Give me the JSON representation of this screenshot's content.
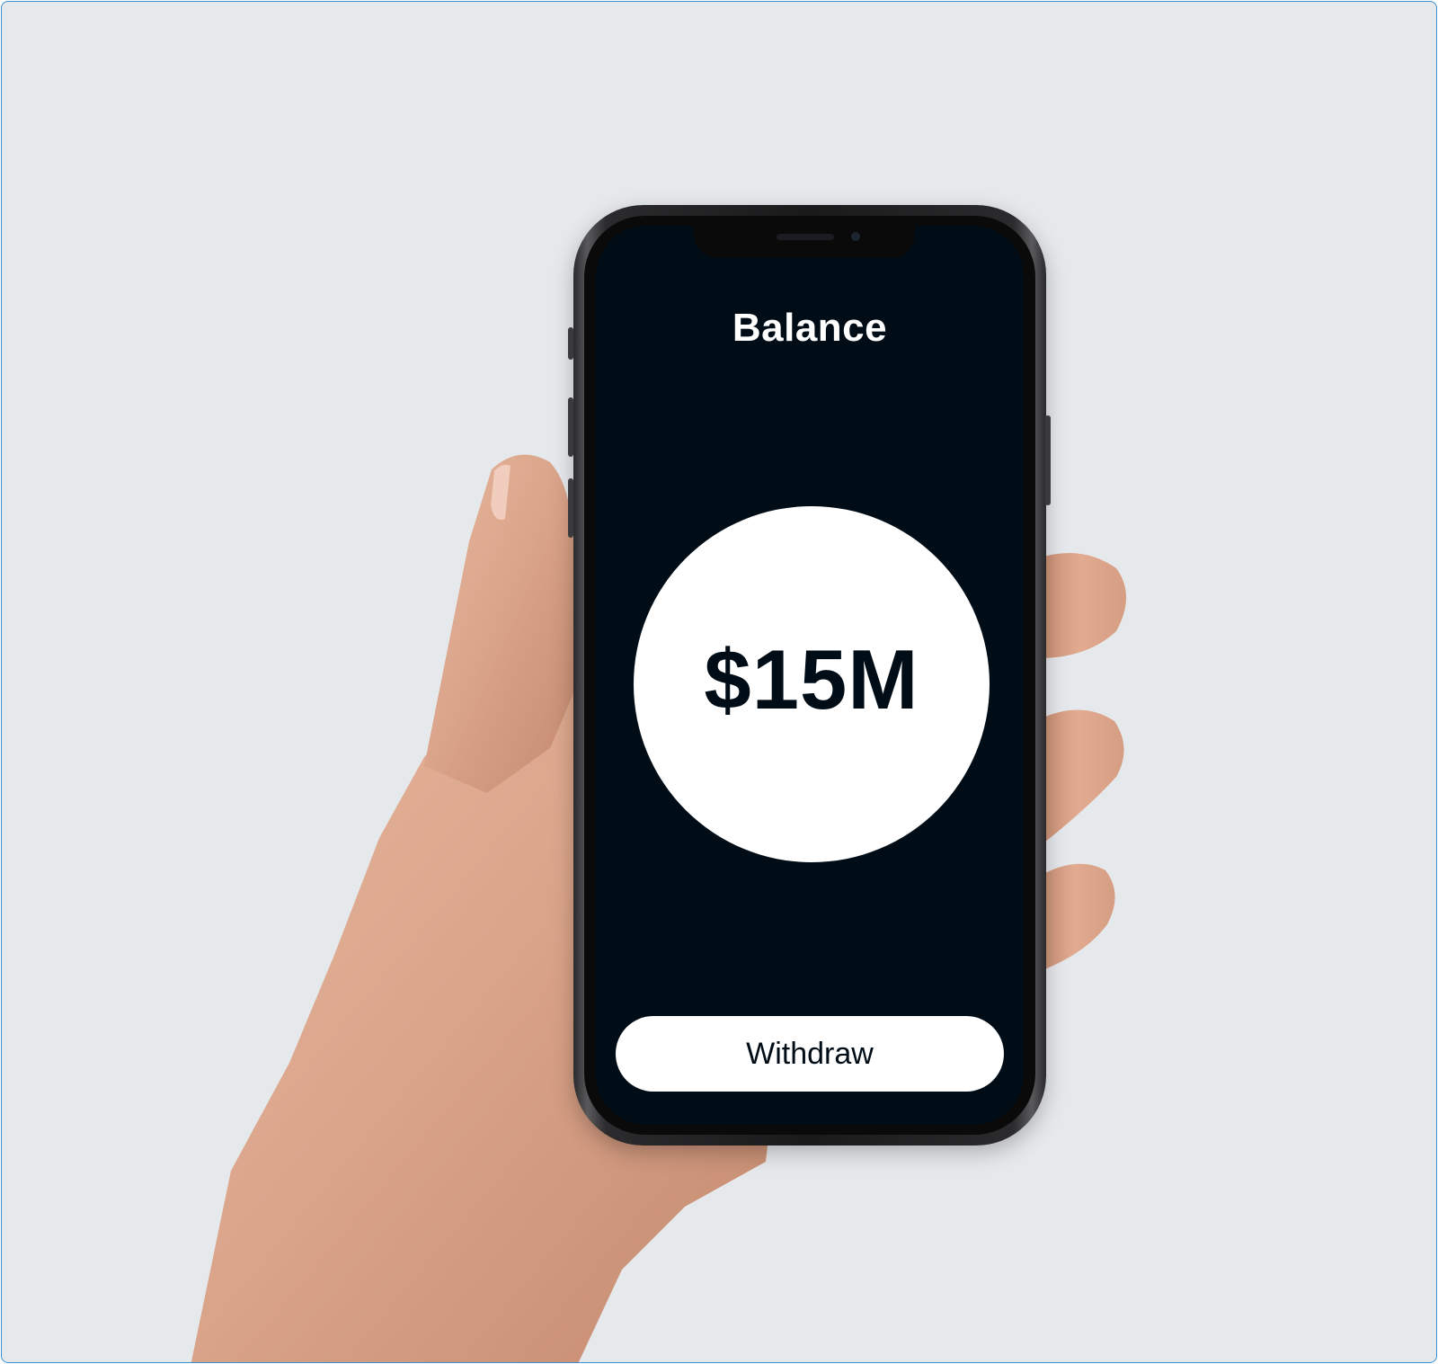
{
  "app": {
    "title": "Balance",
    "balance": "$15M",
    "withdraw_label": "Withdraw"
  },
  "colors": {
    "background": "#e6e9ec",
    "screen": "#000d17",
    "circle": "#ffffff",
    "button": "#ffffff",
    "text_light": "#ffffff",
    "text_dark": "#000d17",
    "skin": "#d9a389"
  }
}
